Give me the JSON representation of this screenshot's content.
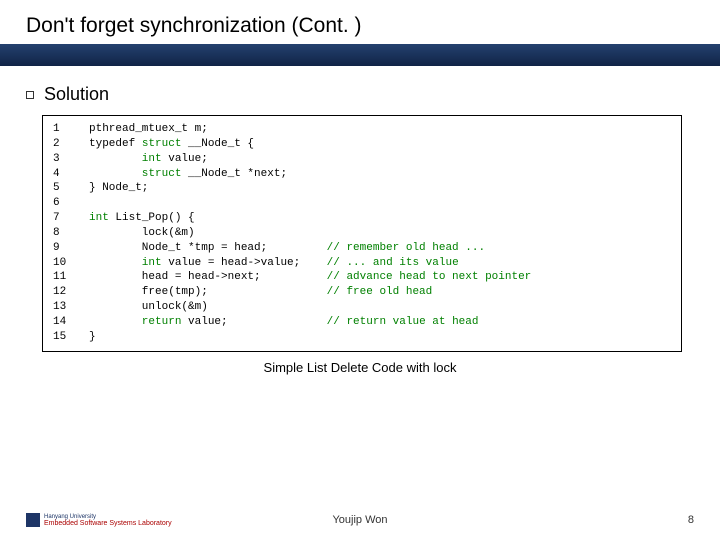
{
  "title": "Don't forget synchronization (Cont. )",
  "section": "Solution",
  "code": {
    "numbers": "1\n2\n3\n4\n5\n6\n7\n8\n9\n10\n11\n12\n13\n14\n15",
    "l1a": "pthread_mtuex_t m;",
    "l2a": "typedef ",
    "l2b": "struct",
    "l2c": " __Node_t {",
    "l3a": "        int",
    "l3b": " value;",
    "l4a": "        struct",
    "l4b": " __Node_t *next;",
    "l5": "} Node_t;",
    "l6": "",
    "l7a": "int",
    "l7b": " List_Pop() {",
    "l8": "        lock(&m)",
    "l9a": "        Node_t *tmp = head;         ",
    "l9b": "// remember old head ...",
    "l10a": "        int",
    "l10b": " value = head->value;    ",
    "l10c": "// ... and its value",
    "l11a": "        head = head->next;          ",
    "l11b": "// advance head to next pointer",
    "l12a": "        free(tmp);                  ",
    "l12b": "// free old head",
    "l13": "        unlock(&m)",
    "l14a": "        return",
    "l14b": " value;               ",
    "l14c": "// return value at head",
    "l15": "}"
  },
  "caption": "Simple List Delete Code with lock",
  "footer": {
    "author": "Youjip Won",
    "page": "8",
    "logo_l1": "Hanyang University",
    "logo_l2": "Embedded Software Systems Laboratory"
  }
}
